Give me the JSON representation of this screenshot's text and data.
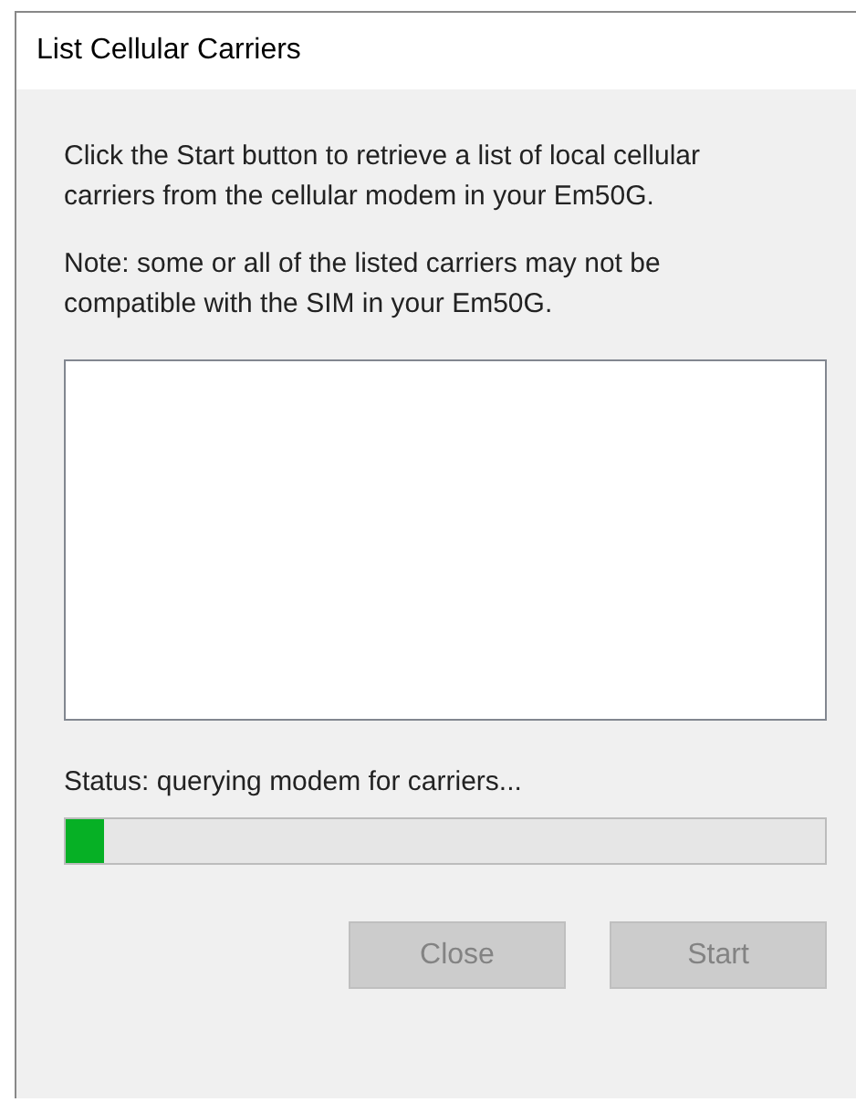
{
  "window": {
    "title": "List Cellular Carriers"
  },
  "instructions": [
    "Click the Start button to retrieve a list of local cellular carriers from the cellular modem in your Em50G.",
    "Note: some or all of the listed carriers may not be compatible with the SIM in your Em50G."
  ],
  "status": {
    "text": "Status: querying modem for carriers...",
    "level": 0.05
  },
  "buttons": [
    {
      "label": "Close",
      "disabled": true
    },
    {
      "label": "Start",
      "disabled": true
    }
  ]
}
